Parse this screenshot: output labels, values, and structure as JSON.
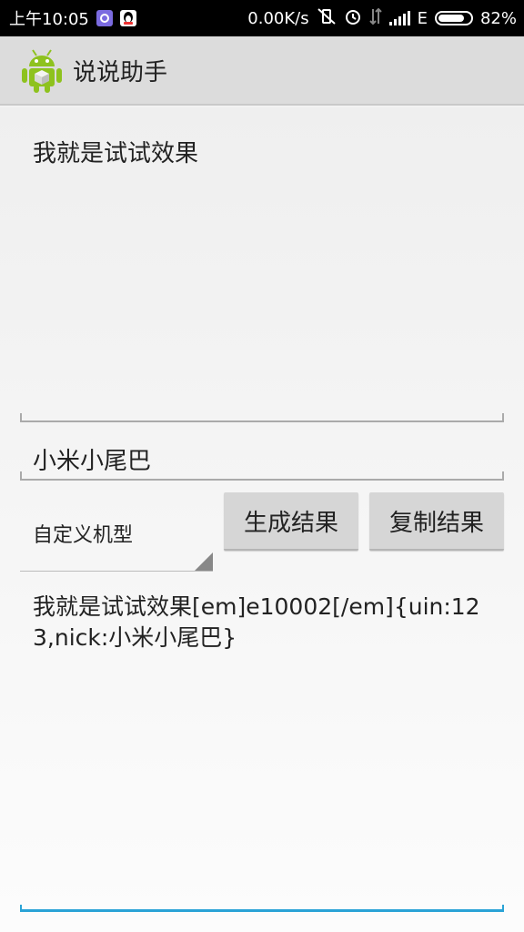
{
  "status_bar": {
    "time": "上午10:05",
    "network_speed": "0.00K/s",
    "network_type": "E",
    "battery_percent": "82%",
    "battery_level": 0.82
  },
  "action_bar": {
    "title": "说说助手",
    "icon": "android-icon"
  },
  "input": {
    "content": "我就是试试效果"
  },
  "tail": {
    "value": "小米小尾巴"
  },
  "model_select": {
    "selected": "自定义机型"
  },
  "buttons": {
    "generate": "生成结果",
    "copy": "复制结果"
  },
  "result": {
    "text": "我就是试试效果[em]e10002[/em]{uin:123,nick:小米小尾巴}"
  },
  "colors": {
    "accent": "#2aa3d6",
    "android_green": "#8ec21e"
  }
}
